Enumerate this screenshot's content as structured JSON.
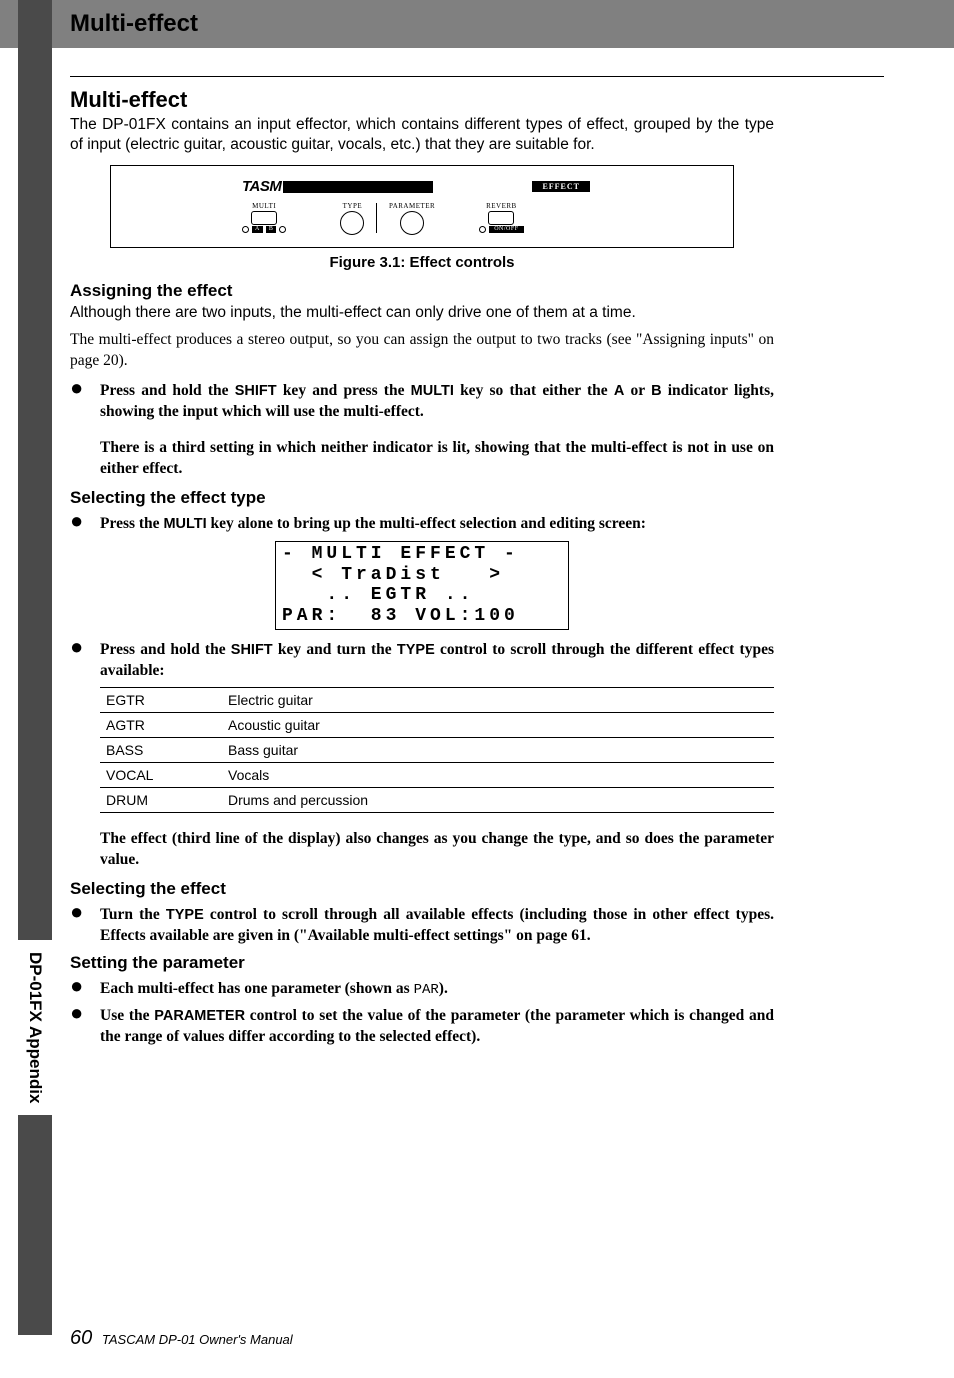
{
  "header": {
    "title": "Multi-effect"
  },
  "sidebar": {
    "label": "DP-01FX Appendix"
  },
  "footer": {
    "page": "60",
    "book": "TASCAM DP-01 Owner's Manual"
  },
  "sections": {
    "multi_effect": {
      "heading": "Multi-effect",
      "intro": "The DP-01FX contains an input effector, which contains different types of effect, grouped by the type of input (electric guitar, acoustic guitar, vocals, etc.) that they are suitable for.",
      "fig_caption": "Figure 3.1: Effect controls",
      "controls": {
        "logo": "TASM",
        "effect_label": "EFFECT",
        "multi": "MULTI",
        "type": "TYPE",
        "parameter": "PARAMETER",
        "reverb": "REVERB",
        "a": "A",
        "b": "B",
        "onoff": "ON/OFF"
      }
    },
    "assigning": {
      "heading": "Assigning the effect",
      "p1": "Although there are two inputs, the multi-effect can only drive one of them at a time.",
      "p2": "The multi-effect produces a stereo output, so you can assign the output to two tracks (see \"Assigning inputs\" on page 20).",
      "bullet1a": "Press and hold the ",
      "bullet1_shift": "SHIFT",
      "bullet1b": " key and press the ",
      "bullet1_multi": "MULTI",
      "bullet1c": " key so that either the ",
      "bullet1_a": "A",
      "bullet1d": " or ",
      "bullet1_b": "B",
      "bullet1e": " indicator lights, showing the input which will use the multi-effect.",
      "follow": "There is a third setting in which neither indicator is lit, showing that the multi-effect is not in use on either effect."
    },
    "selecting_type": {
      "heading": "Selecting the effect type",
      "bullet1a": "Press the ",
      "bullet1_multi": "MULTI",
      "bullet1b": " key alone to bring up the multi-effect selection and editing screen:",
      "lcd": "- MULTI EFFECT -\n  < TraDist   >\n   .. EGTR ..\nPAR:  83 VOL:100",
      "bullet2a": "Press and hold the ",
      "bullet2_shift": "SHIFT",
      "bullet2b": " key and turn the ",
      "bullet2_type": "TYPE",
      "bullet2c": " control to scroll through the different effect types available:",
      "table": [
        {
          "code": "EGTR",
          "label": "Electric guitar"
        },
        {
          "code": "AGTR",
          "label": "Acoustic guitar"
        },
        {
          "code": "BASS",
          "label": "Bass guitar"
        },
        {
          "code": "VOCAL",
          "label": "Vocals"
        },
        {
          "code": "DRUM",
          "label": "Drums and percussion"
        }
      ],
      "follow": "The effect (third line of the display) also changes as you change the type, and so does the parameter value."
    },
    "selecting_effect": {
      "heading": "Selecting the effect",
      "bullet1a": "Turn the ",
      "bullet1_type": "TYPE",
      "bullet1b": " control to scroll through all available effects (including those in other effect types. Effects available are given in (\"Available multi-effect settings\" on page 61."
    },
    "setting_param": {
      "heading": "Setting the parameter",
      "bullet1a": "Each multi-effect has one parameter (shown as ",
      "bullet1_par": "PAR",
      "bullet1b": ").",
      "bullet2a": "Use the ",
      "bullet2_param": "PARAMETER",
      "bullet2b": " control to set the value of the parameter (the parameter which is changed and the range of values differ according to the selected effect)."
    }
  }
}
